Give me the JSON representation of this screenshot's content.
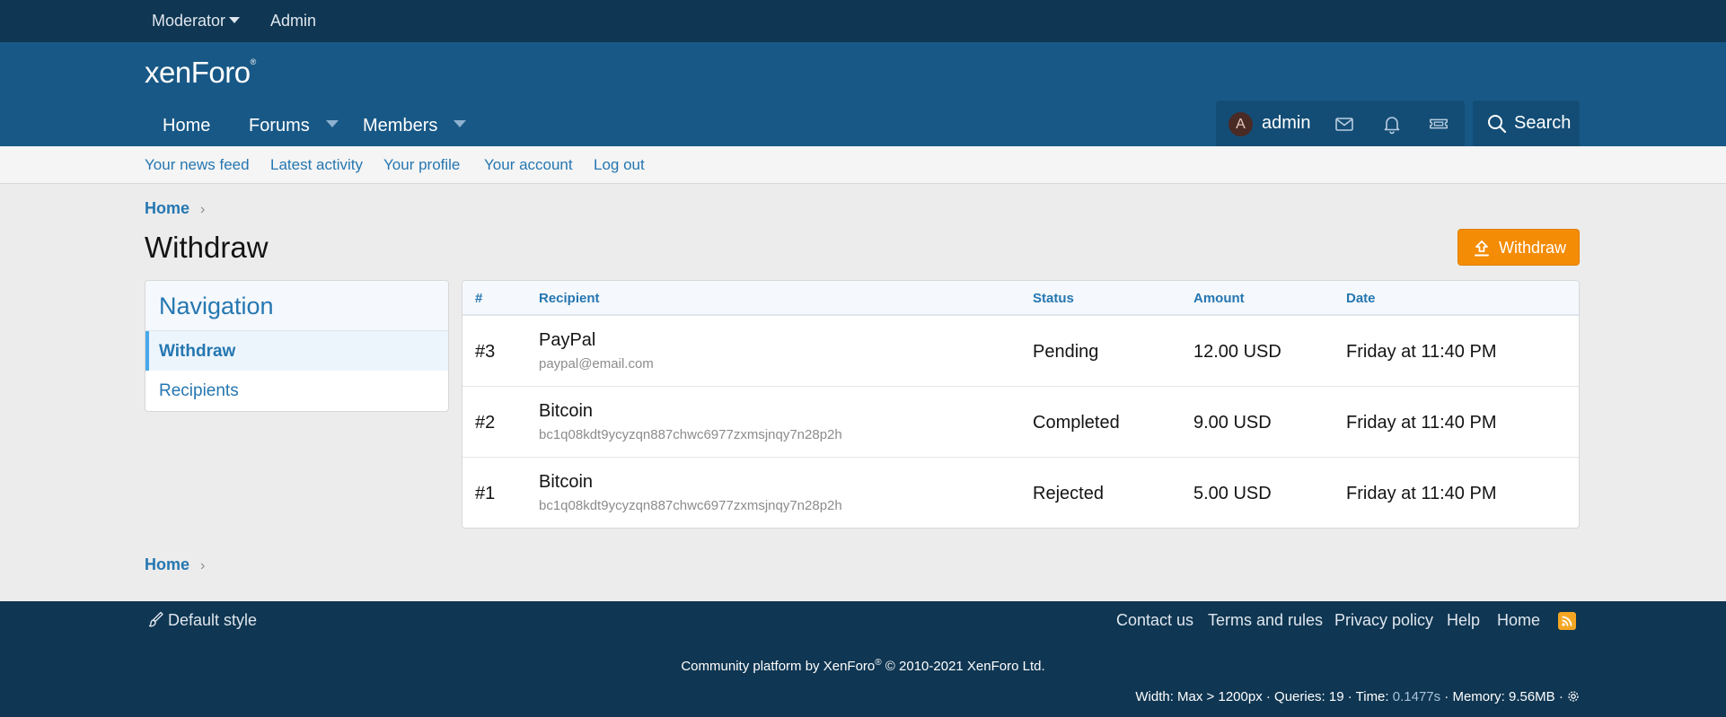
{
  "staff_bar": {
    "moderator": "Moderator",
    "admin": "Admin"
  },
  "header": {
    "logo_xen": "xen",
    "logo_foro": "Foro",
    "logo_mark": "®",
    "nav": {
      "home": "Home",
      "forums": "Forums",
      "members": "Members"
    },
    "user": {
      "avatar_letter": "A",
      "name": "admin"
    },
    "search_label": "Search"
  },
  "sub_nav": {
    "news_feed": "Your news feed",
    "latest_activity": "Latest activity",
    "profile": "Your profile",
    "account": "Your account",
    "logout": "Log out"
  },
  "breadcrumb": {
    "home": "Home",
    "chevron": "›"
  },
  "page": {
    "title": "Withdraw",
    "action_button": "Withdraw"
  },
  "navigation": {
    "title": "Navigation",
    "items": [
      {
        "label": "Withdraw",
        "active": true
      },
      {
        "label": "Recipients",
        "active": false
      }
    ]
  },
  "table": {
    "headers": {
      "num": "#",
      "recipient": "Recipient",
      "status": "Status",
      "amount": "Amount",
      "date": "Date"
    },
    "rows": [
      {
        "num": "#3",
        "recipient": "PayPal",
        "recipient_detail": "paypal@email.com",
        "status": "Pending",
        "amount": "12.00 USD",
        "date": "Friday at 11:40 PM"
      },
      {
        "num": "#2",
        "recipient": "Bitcoin",
        "recipient_detail": "bc1q08kdt9ycyzqn887chwc6977zxmsjnqy7n28p2h",
        "status": "Completed",
        "amount": "9.00 USD",
        "date": "Friday at 11:40 PM"
      },
      {
        "num": "#1",
        "recipient": "Bitcoin",
        "recipient_detail": "bc1q08kdt9ycyzqn887chwc6977zxmsjnqy7n28p2h",
        "status": "Rejected",
        "amount": "5.00 USD",
        "date": "Friday at 11:40 PM"
      }
    ]
  },
  "footer": {
    "style_chooser": "Default style",
    "links": {
      "contact": "Contact us",
      "terms": "Terms and rules",
      "privacy": "Privacy policy",
      "help": "Help",
      "home": "Home"
    },
    "copyright_a": "Community platform by XenForo",
    "copyright_mark": "®",
    "copyright_b": " © 2010-2021 XenForo Ltd.",
    "debug_a": "Width: Max > 1200px · Queries: 19 · Time: ",
    "debug_time": "0.1477s",
    "debug_b": " · Memory: 9.56MB · "
  },
  "colors": {
    "staff_bar": "#0f3652",
    "header": "#185886",
    "link": "#2577b1",
    "accent_button": "#f48c06",
    "footer": "#0f3652"
  },
  "icons": [
    "chevron-down-icon",
    "avatar",
    "envelope-icon",
    "bell-icon",
    "ticket-icon",
    "search-icon",
    "upload-icon",
    "brush-icon",
    "rss-icon",
    "gear-icon"
  ]
}
